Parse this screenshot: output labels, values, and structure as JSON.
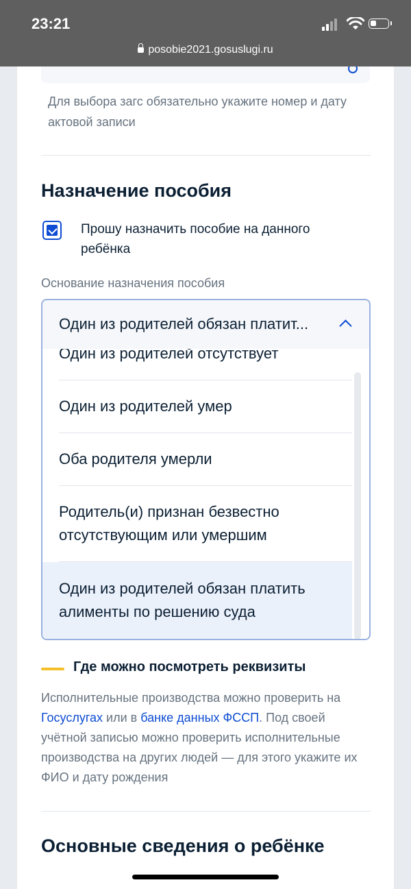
{
  "status_bar": {
    "time": "23:21",
    "url": "posobie2021.gosuslugi.ru"
  },
  "zags": {
    "hint": "Для выбора загс обязательно укажите номер и дату актовой записи"
  },
  "benefit": {
    "title": "Назначение пособия",
    "checkbox_label": "Прошу назначить пособие на данного ребёнка",
    "checkbox_checked": true,
    "basis_label": "Основание назначения пособия",
    "selected_value": "Один из родителей обязан платит...",
    "options": [
      "Один из родителей отсутствует",
      "Один из родителей умер",
      "Оба родителя умерли",
      "Родитель(и) признан безвестно отсутствующим или умершим",
      "Один из родителей обязан платить алименты по решению суда"
    ]
  },
  "info": {
    "title": "Где можно посмотреть реквизиты",
    "text_1": "Исполнительные производства можно проверить на ",
    "link_1": "Госуслугах",
    "text_2": " или в ",
    "link_2": "банке данных ФССП",
    "text_3": ". Под своей учётной записью можно проверить исполнительные производства на других людей — для этого укажите их ФИО и дату рождения"
  },
  "child": {
    "title": "Основные сведения о ребёнке"
  }
}
